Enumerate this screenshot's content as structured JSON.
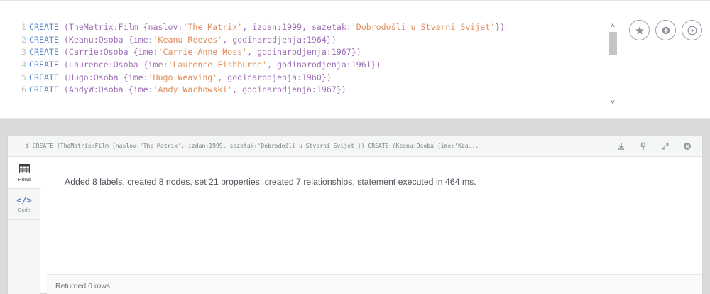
{
  "editor": {
    "lines": [
      {
        "n": "1",
        "name": "TheMatrix",
        "label": "Film",
        "props": [
          [
            "naslov",
            "'The Matrix'"
          ],
          [
            "izdan",
            "1999"
          ],
          [
            "sazetak",
            "'Dobrodošli u Stvarni Svijet'"
          ]
        ]
      },
      {
        "n": "2",
        "name": "Keanu",
        "label": "Osoba",
        "props": [
          [
            "ime",
            "'Keanu Reeves'"
          ],
          [
            "godinarodjenja",
            "1964"
          ]
        ]
      },
      {
        "n": "3",
        "name": "Carrie",
        "label": "Osoba",
        "props": [
          [
            "ime",
            "'Carrie-Anne Moss'"
          ],
          [
            "godinarodjenja",
            "1967"
          ]
        ]
      },
      {
        "n": "4",
        "name": "Laurence",
        "label": "Osoba",
        "props": [
          [
            "ime",
            "'Laurence Fishburne'"
          ],
          [
            "godinarodjenja",
            "1961"
          ]
        ]
      },
      {
        "n": "5",
        "name": "Hugo",
        "label": "Osoba",
        "props": [
          [
            "ime",
            "'Hugo Weaving'"
          ],
          [
            "godinarodjenja",
            "1960"
          ]
        ]
      },
      {
        "n": "6",
        "name": "AndyW",
        "label": "Osoba",
        "props": [
          [
            "ime",
            "'Andy Wachowski'"
          ],
          [
            "godinarodjenja",
            "1967"
          ]
        ]
      }
    ],
    "keyword": "CREATE",
    "actions": [
      "star-icon",
      "plus-icon",
      "play-icon"
    ]
  },
  "frame": {
    "command": "$ CREATE (TheMatrix:Film {naslov:'The Matrix', izdan:1999, sazetak:'Dobrodošli u Stvarni Svijet'}) CREATE (Keanu:Osoba {ime:'Kea...",
    "header_icons": [
      "download-icon",
      "pin-icon",
      "expand-icon",
      "close-icon"
    ],
    "sidebar": [
      {
        "label": "Rows",
        "icon": "table-icon",
        "active": true
      },
      {
        "label": "Code",
        "icon": "code-icon",
        "active": false
      }
    ],
    "message": "Added 8 labels, created 8 nodes, set 21 properties, created 7 relationships, statement executed in 464 ms.",
    "footer": "Returned 0 rows."
  },
  "colors": {
    "keyword": "#5b89c7",
    "label": "#a070b8",
    "string": "#e08c5a",
    "background": "#d9dadb"
  }
}
